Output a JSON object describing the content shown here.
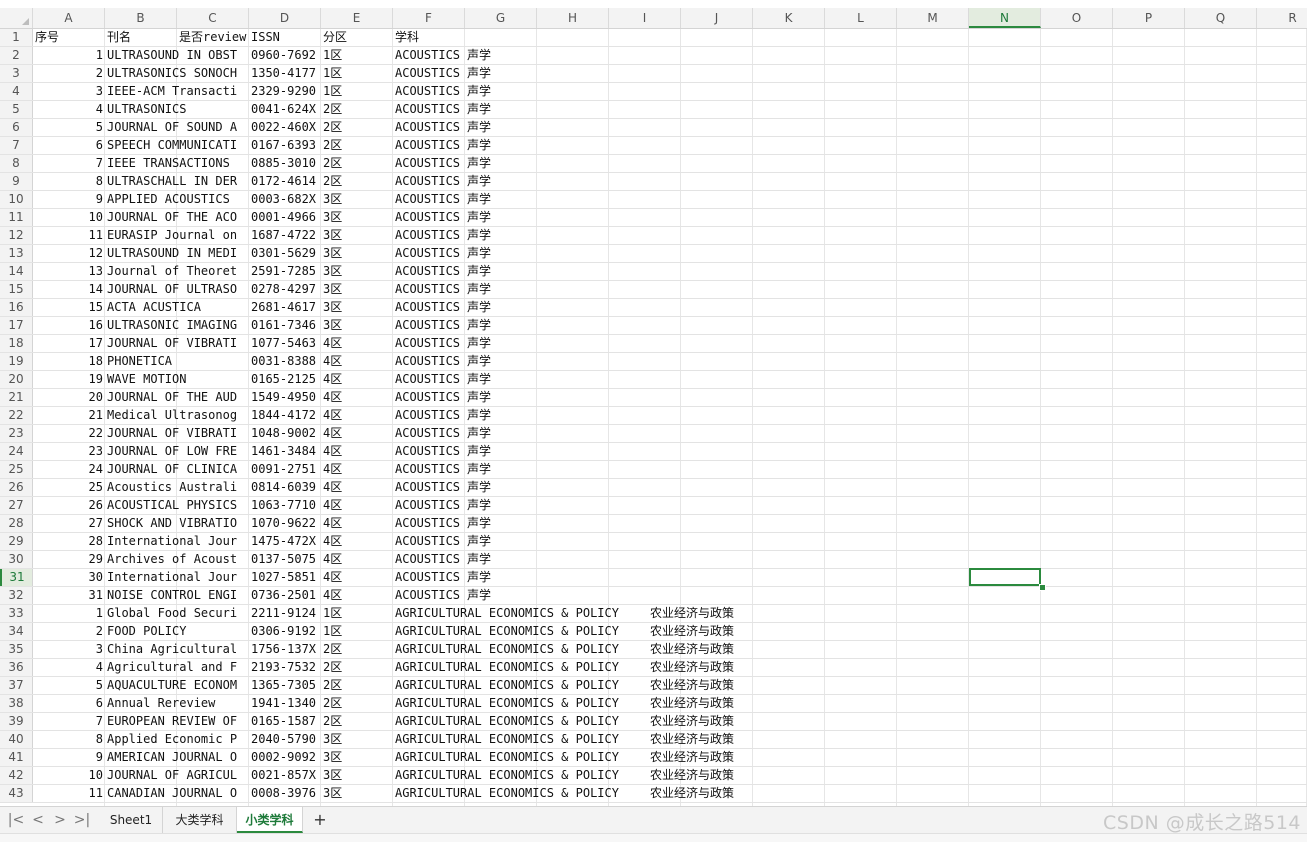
{
  "columns": [
    "A",
    "B",
    "C",
    "D",
    "E",
    "F",
    "G",
    "H",
    "I",
    "J",
    "K",
    "L",
    "M",
    "N",
    "O",
    "P",
    "Q",
    "R"
  ],
  "active_column": "N",
  "active_row": 31,
  "header_row": [
    "序号",
    "刊名",
    "是否review",
    "ISSN",
    "分区",
    "学科"
  ],
  "rows": [
    [
      "1",
      "ULTRASOUND IN OBST",
      "0960-7692",
      "1区",
      "ACOUSTICS",
      "声学"
    ],
    [
      "2",
      "ULTRASONICS SONOCH",
      "1350-4177",
      "1区",
      "ACOUSTICS",
      "声学"
    ],
    [
      "3",
      "IEEE-ACM Transacti",
      "2329-9290",
      "1区",
      "ACOUSTICS",
      "声学"
    ],
    [
      "4",
      "ULTRASONICS",
      "0041-624X",
      "2区",
      "ACOUSTICS",
      "声学"
    ],
    [
      "5",
      "JOURNAL OF SOUND A",
      "0022-460X",
      "2区",
      "ACOUSTICS",
      "声学"
    ],
    [
      "6",
      "SPEECH COMMUNICATI",
      "0167-6393",
      "2区",
      "ACOUSTICS",
      "声学"
    ],
    [
      "7",
      "IEEE TRANSACTIONS ",
      "0885-3010",
      "2区",
      "ACOUSTICS",
      "声学"
    ],
    [
      "8",
      "ULTRASCHALL IN DER",
      "0172-4614",
      "2区",
      "ACOUSTICS",
      "声学"
    ],
    [
      "9",
      "APPLIED ACOUSTICS",
      "0003-682X",
      "3区",
      "ACOUSTICS",
      "声学"
    ],
    [
      "10",
      "JOURNAL OF THE ACO",
      "0001-4966",
      "3区",
      "ACOUSTICS",
      "声学"
    ],
    [
      "11",
      "EURASIP Journal on",
      "1687-4722",
      "3区",
      "ACOUSTICS",
      "声学"
    ],
    [
      "12",
      "ULTRASOUND IN MEDI",
      "0301-5629",
      "3区",
      "ACOUSTICS",
      "声学"
    ],
    [
      "13",
      "Journal of Theoret",
      "2591-7285",
      "3区",
      "ACOUSTICS",
      "声学"
    ],
    [
      "14",
      "JOURNAL OF ULTRASO",
      "0278-4297",
      "3区",
      "ACOUSTICS",
      "声学"
    ],
    [
      "15",
      "ACTA ACUSTICA",
      "2681-4617",
      "3区",
      "ACOUSTICS",
      "声学"
    ],
    [
      "16",
      "ULTRASONIC IMAGING",
      "0161-7346",
      "3区",
      "ACOUSTICS",
      "声学"
    ],
    [
      "17",
      "JOURNAL OF VIBRATI",
      "1077-5463",
      "4区",
      "ACOUSTICS",
      "声学"
    ],
    [
      "18",
      "PHONETICA",
      "0031-8388",
      "4区",
      "ACOUSTICS",
      "声学"
    ],
    [
      "19",
      "WAVE MOTION",
      "0165-2125",
      "4区",
      "ACOUSTICS",
      "声学"
    ],
    [
      "20",
      "JOURNAL OF THE AUD",
      "1549-4950",
      "4区",
      "ACOUSTICS",
      "声学"
    ],
    [
      "21",
      "Medical Ultrasonog",
      "1844-4172",
      "4区",
      "ACOUSTICS",
      "声学"
    ],
    [
      "22",
      "JOURNAL OF VIBRATI",
      "1048-9002",
      "4区",
      "ACOUSTICS",
      "声学"
    ],
    [
      "23",
      "JOURNAL OF LOW FRE",
      "1461-3484",
      "4区",
      "ACOUSTICS",
      "声学"
    ],
    [
      "24",
      "JOURNAL OF CLINICA",
      "0091-2751",
      "4区",
      "ACOUSTICS",
      "声学"
    ],
    [
      "25",
      "Acoustics Australi",
      "0814-6039",
      "4区",
      "ACOUSTICS",
      "声学"
    ],
    [
      "26",
      "ACOUSTICAL PHYSICS",
      "1063-7710",
      "4区",
      "ACOUSTICS",
      "声学"
    ],
    [
      "27",
      "SHOCK AND VIBRATIO",
      "1070-9622",
      "4区",
      "ACOUSTICS",
      "声学"
    ],
    [
      "28",
      "International Jour",
      "1475-472X",
      "4区",
      "ACOUSTICS",
      "声学"
    ],
    [
      "29",
      "Archives of Acoust",
      "0137-5075",
      "4区",
      "ACOUSTICS",
      "声学"
    ],
    [
      "30",
      "International Jour",
      "1027-5851",
      "4区",
      "ACOUSTICS",
      "声学"
    ],
    [
      "31",
      "NOISE CONTROL ENGI",
      "0736-2501",
      "4区",
      "ACOUSTICS",
      "声学"
    ],
    [
      "1",
      "Global Food Securi",
      "2211-9124",
      "1区",
      "AGRICULTURAL ECONOMICS & POLICY",
      "农业经济与政策"
    ],
    [
      "2",
      "FOOD POLICY",
      "0306-9192",
      "1区",
      "AGRICULTURAL ECONOMICS & POLICY",
      "农业经济与政策"
    ],
    [
      "3",
      "China Agricultural",
      "1756-137X",
      "2区",
      "AGRICULTURAL ECONOMICS & POLICY",
      "农业经济与政策"
    ],
    [
      "4",
      "Agricultural and F",
      "2193-7532",
      "2区",
      "AGRICULTURAL ECONOMICS & POLICY",
      "农业经济与政策"
    ],
    [
      "5",
      "AQUACULTURE ECONOM",
      "1365-7305",
      "2区",
      "AGRICULTURAL ECONOMICS & POLICY",
      "农业经济与政策"
    ],
    [
      "6",
      "Annual Rereview",
      "1941-1340",
      "2区",
      "AGRICULTURAL ECONOMICS & POLICY",
      "农业经济与政策"
    ],
    [
      "7",
      "EUROPEAN REVIEW OF",
      "0165-1587",
      "2区",
      "AGRICULTURAL ECONOMICS & POLICY",
      "农业经济与政策"
    ],
    [
      "8",
      "Applied Economic P",
      "2040-5790",
      "3区",
      "AGRICULTURAL ECONOMICS & POLICY",
      "农业经济与政策"
    ],
    [
      "9",
      "AMERICAN JOURNAL O",
      "0002-9092",
      "3区",
      "AGRICULTURAL ECONOMICS & POLICY",
      "农业经济与政策"
    ],
    [
      "10",
      "JOURNAL OF AGRICUL",
      "0021-857X",
      "3区",
      "AGRICULTURAL ECONOMICS & POLICY",
      "农业经济与政策"
    ],
    [
      "11",
      "CANADIAN JOURNAL O",
      "0008-3976",
      "3区",
      "AGRICULTURAL ECONOMICS & POLICY",
      "农业经济与政策"
    ]
  ],
  "tabs": [
    "Sheet1",
    "大类学科",
    "小类学科"
  ],
  "active_tab": "小类学科",
  "nav": {
    "first": "|<",
    "prev": "<",
    "next": ">",
    "last": ">|",
    "add": "+"
  },
  "watermark": "CSDN @成长之路514",
  "colors": {
    "accent": "#2b8a3e",
    "header_bg": "#f3f3f3",
    "grid": "#e3e3e3"
  }
}
